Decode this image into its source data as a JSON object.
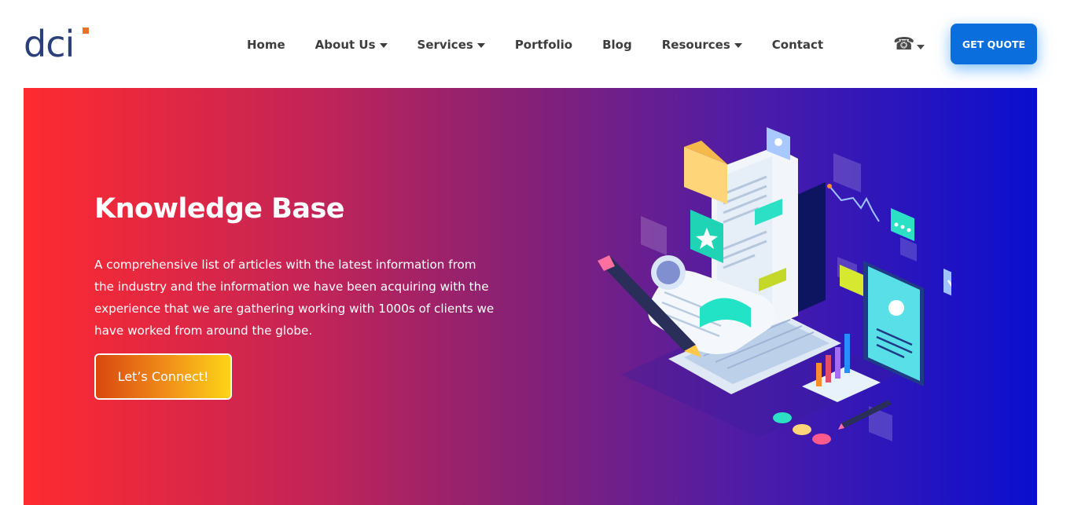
{
  "brand": {
    "logo_text": "dci",
    "accent": "#e6732a",
    "logo_color": "#2b3f7a"
  },
  "nav": {
    "items": [
      {
        "label": "Home",
        "dropdown": false
      },
      {
        "label": "About Us",
        "dropdown": true
      },
      {
        "label": "Services",
        "dropdown": true
      },
      {
        "label": "Portfolio",
        "dropdown": false
      },
      {
        "label": "Blog",
        "dropdown": false
      },
      {
        "label": "Resources",
        "dropdown": true
      },
      {
        "label": "Contact",
        "dropdown": false
      }
    ]
  },
  "header": {
    "phone_icon": "phone-icon",
    "quote_label": "GET QUOTE",
    "quote_color": "#0a6fdc"
  },
  "hero": {
    "title": "Knowledge Base",
    "description": "A comprehensive list of articles with the latest information from the industry and the information we have been acquiring with the experience that we are gathering working with 1000s of clients we have worked from around the globe.",
    "cta_label": "Let’s Connect!",
    "gradient_start": "#ff2b2f",
    "gradient_end": "#0a0fcf"
  }
}
